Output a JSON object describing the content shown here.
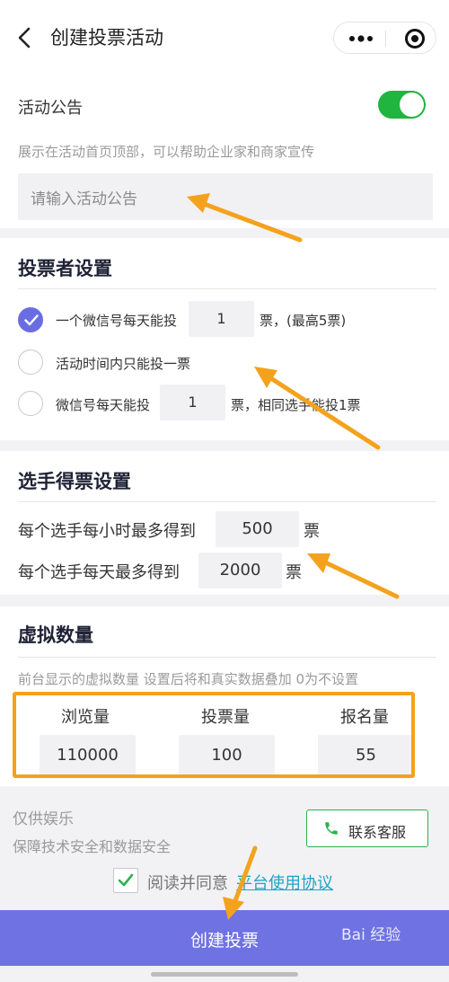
{
  "nav": {
    "title": "创建投票活动"
  },
  "announcement": {
    "label": "活动公告",
    "toggle_on": true,
    "hint": "展示在活动首页顶部，可以帮助企业家和商家宣传",
    "placeholder": "请输入活动公告"
  },
  "voter_settings": {
    "title": "投票者设置",
    "options": [
      {
        "prefix": "一个微信号每天能投",
        "value": "1",
        "suffix": "票，(最高5票)",
        "selected": true
      },
      {
        "prefix": "活动时间内只能投一票",
        "selected": false
      },
      {
        "prefix": "微信号每天能投",
        "value": "1",
        "suffix": "票，相同选手能投1票",
        "selected": false
      }
    ]
  },
  "candidate_settings": {
    "title": "选手得票设置",
    "per_hour_label": "每个选手每小时最多得到",
    "per_hour_value": "500",
    "per_day_label": "每个选手每天最多得到",
    "per_day_value": "2000",
    "unit": "票"
  },
  "virtual": {
    "title": "虚拟数量",
    "hint": "前台显示的虚拟数量 设置后将和真实数据叠加 0为不设置",
    "columns": [
      {
        "label": "浏览量",
        "value": "110000"
      },
      {
        "label": "投票量",
        "value": "100"
      },
      {
        "label": "报名量",
        "value": "55"
      }
    ]
  },
  "footer": {
    "entertainment": "仅供娱乐",
    "security": "保障技术安全和数据安全",
    "contact_button": "联系客服",
    "agree_prefix": "阅读并同意",
    "agree_link": "平台使用协议",
    "create_button": "创建投票"
  },
  "watermark": "Bai 经验",
  "colors": {
    "accent": "#6f72e3",
    "toggle": "#1fb53f",
    "annotation": "#f4a21d"
  }
}
